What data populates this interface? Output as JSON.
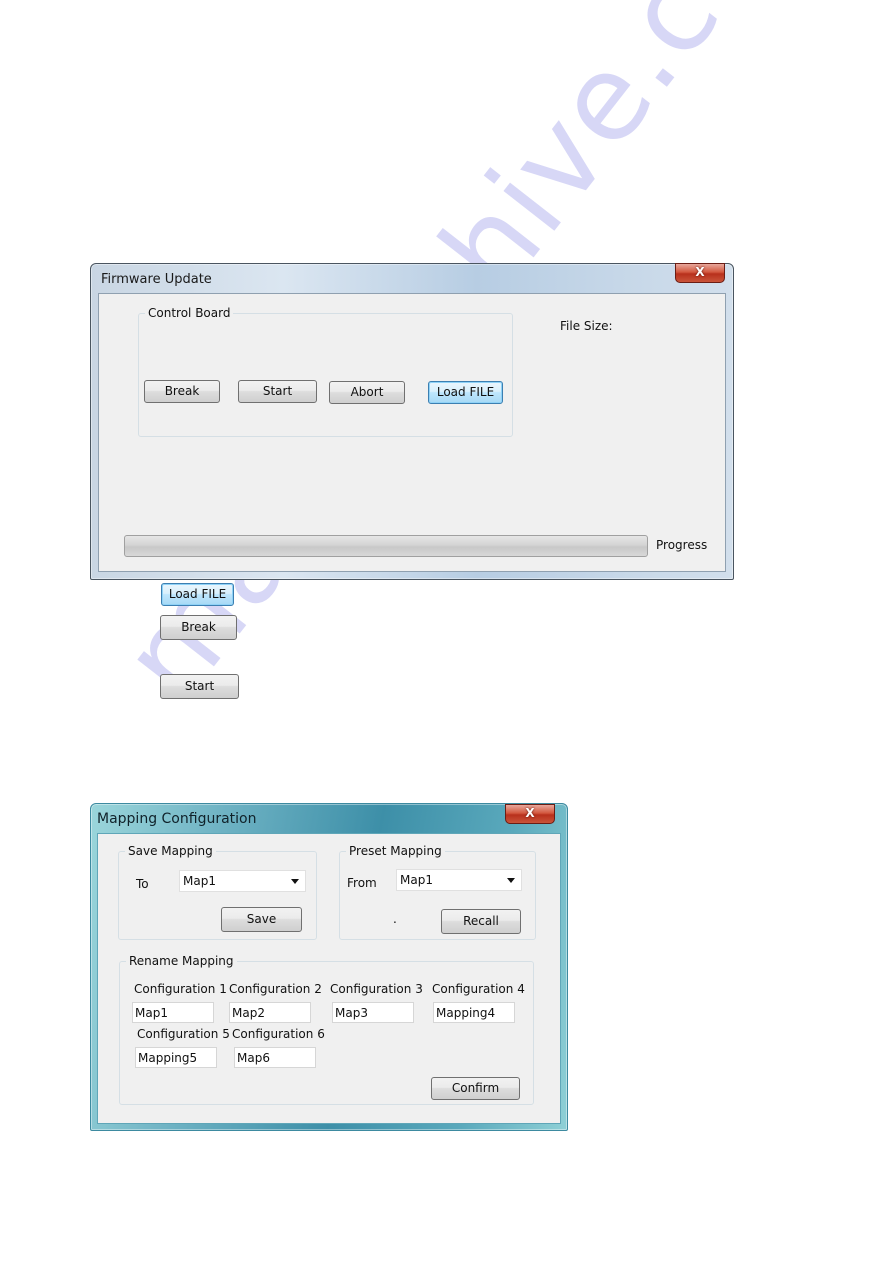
{
  "firmware_window": {
    "title": "Firmware Update",
    "close_label": "X",
    "control_board": {
      "label": "Control Board",
      "buttons": {
        "break": "Break",
        "start": "Start",
        "abort": "Abort",
        "load_file": "Load FILE"
      }
    },
    "file_size_label": "File Size:",
    "file_size_value": "",
    "progress_label": "Progress",
    "progress_percent": 0
  },
  "standalone_buttons": {
    "load_file": "Load FILE",
    "break": "Break",
    "start": "Start"
  },
  "mapping_window": {
    "title": "Mapping Configuration",
    "close_label": "X",
    "save_mapping": {
      "label": "Save Mapping",
      "to_label": "To",
      "selected": "Map1",
      "save_button": "Save"
    },
    "preset_mapping": {
      "label": "Preset Mapping",
      "from_label": "From",
      "selected": "Map1",
      "dot_label": ".",
      "recall_button": "Recall"
    },
    "rename_mapping": {
      "label": "Rename Mapping",
      "configurations": [
        {
          "label": "Configuration 1",
          "value": "Map1"
        },
        {
          "label": "Configuration 2",
          "value": "Map2"
        },
        {
          "label": "Configuration 3",
          "value": "Map3"
        },
        {
          "label": "Configuration 4",
          "value": "Mapping4"
        },
        {
          "label": "Configuration 5",
          "value": "Mapping5"
        },
        {
          "label": "Configuration 6",
          "value": "Map6"
        }
      ],
      "confirm_button": "Confirm"
    }
  },
  "watermark": "manualshive.com",
  "colors": {
    "focus_button_border": "#3c7fb1",
    "close_button_red": "#c9543a",
    "mapping_frame_teal": "#5aa9bc",
    "watermark": "#8c8ce6"
  }
}
